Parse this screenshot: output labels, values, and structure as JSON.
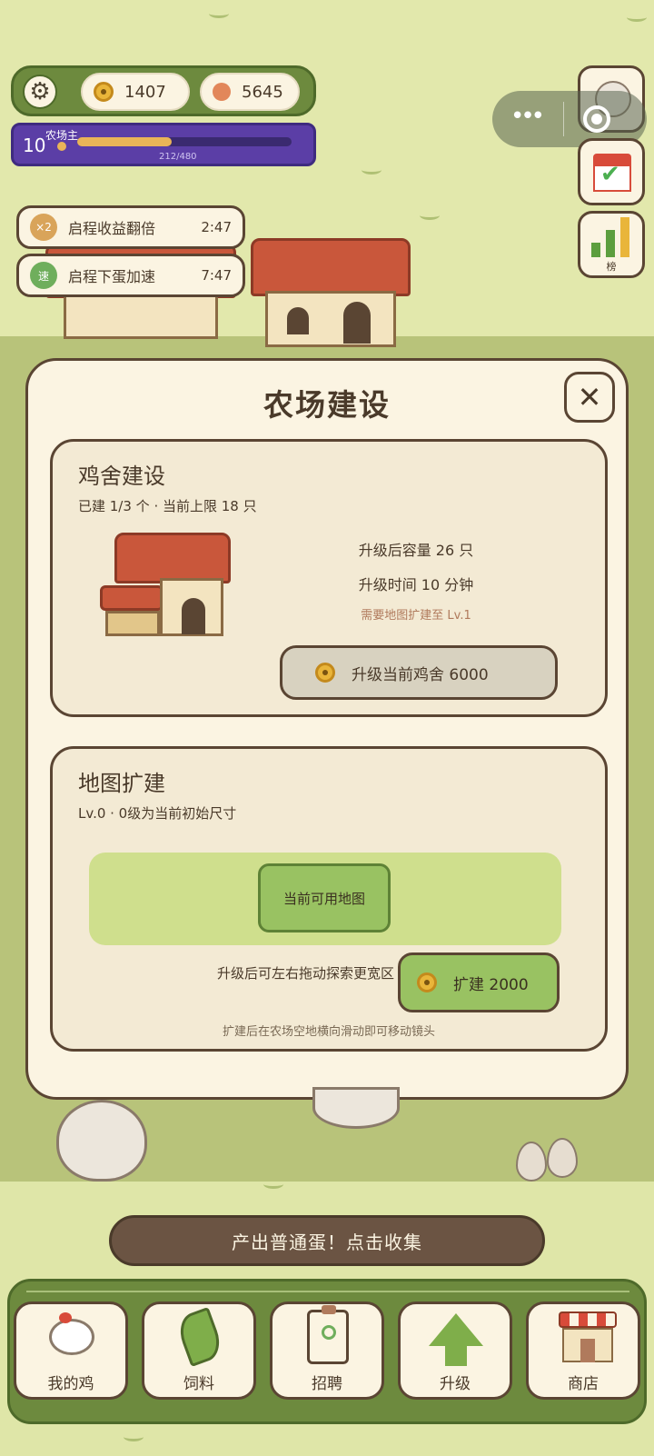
{
  "status": {
    "coins": "1407",
    "gems": "5645"
  },
  "level": {
    "number": "10",
    "title": "农场主",
    "xp_text": "212/480",
    "xp_fraction": 0.44
  },
  "buffs": [
    {
      "badge": "×2",
      "label": "启程收益翻倍",
      "time": "2:47",
      "color": "#d9a45a"
    },
    {
      "badge": "速",
      "label": "启程下蛋加速",
      "time": "7:47",
      "color": "#6fae5c"
    }
  ],
  "side": {
    "rank_label": "榜"
  },
  "modal": {
    "title": "农场建设",
    "close": "✕",
    "coop_card": {
      "heading": "鸡舍建设",
      "summary": "已建 1/3 个 · 当前上限 18 只",
      "capacity_after": "升级后容量 26 只",
      "upgrade_time": "升级时间 10 分钟",
      "requirement": "需要地图扩建至 Lv.1",
      "upgrade_button": "升级当前鸡舍 6000"
    },
    "map_card": {
      "heading": "地图扩建",
      "summary": "Lv.0 · 0级为当前初始尺寸",
      "current_map": "当前可用地图",
      "hint": "升级后可左右拖动探索更宽区",
      "expand_button": "扩建 2000",
      "footer": "扩建后在农场空地横向滑动即可移动镜头"
    }
  },
  "collect_bar": "产出普通蛋！点击收集",
  "nav": [
    {
      "label": "我的鸡",
      "icon": "chicken-icon"
    },
    {
      "label": "饲料",
      "icon": "leaf-icon"
    },
    {
      "label": "招聘",
      "icon": "badge-icon"
    },
    {
      "label": "升级",
      "icon": "arrow-up-icon"
    },
    {
      "label": "商店",
      "icon": "shop-icon"
    }
  ]
}
